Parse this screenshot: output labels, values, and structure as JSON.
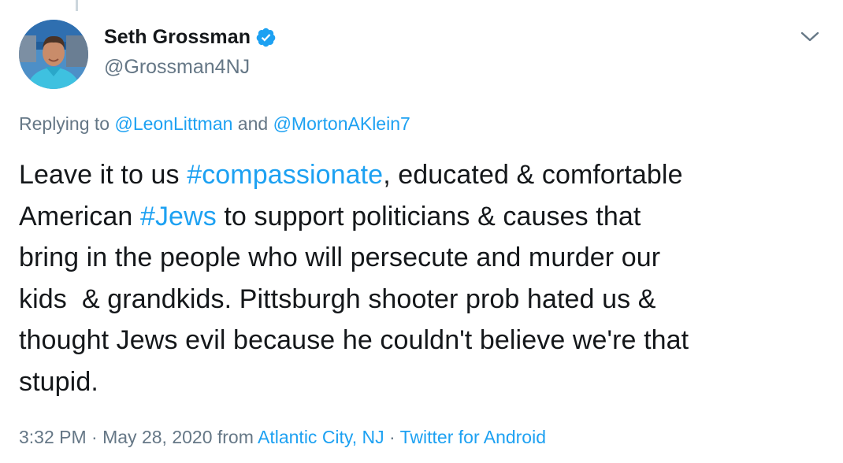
{
  "author": {
    "display_name": "Seth Grossman",
    "handle": "@Grossman4NJ",
    "verified_icon": "verified-badge-icon",
    "avatar_icon": "avatar"
  },
  "reply": {
    "prefix": "Replying to ",
    "mention_1": "@LeonLittman",
    "conjunction": " and ",
    "mention_2": "@MortonAKlein7"
  },
  "tweet": {
    "seg_1": "Leave it to us ",
    "hashtag_1": "#compassionate",
    "seg_2": ", educated & comfortable\nAmerican ",
    "hashtag_2": "#Jews",
    "seg_3": " to support politicians & causes that\nbring in the people who will persecute and murder our\nkids  & grandkids. Pittsburgh shooter prob hated us &\nthought Jews evil because he couldn't believe we're that\nstupid."
  },
  "meta": {
    "time": "3:32 PM",
    "sep_1": " · ",
    "date": "May 28, 2020",
    "from": " from ",
    "location": "Atlantic City, NJ",
    "sep_2": " · ",
    "source": "Twitter for Android"
  },
  "colors": {
    "link": "#1da1f2",
    "secondary_text": "#657786",
    "primary_text": "#14171a"
  }
}
